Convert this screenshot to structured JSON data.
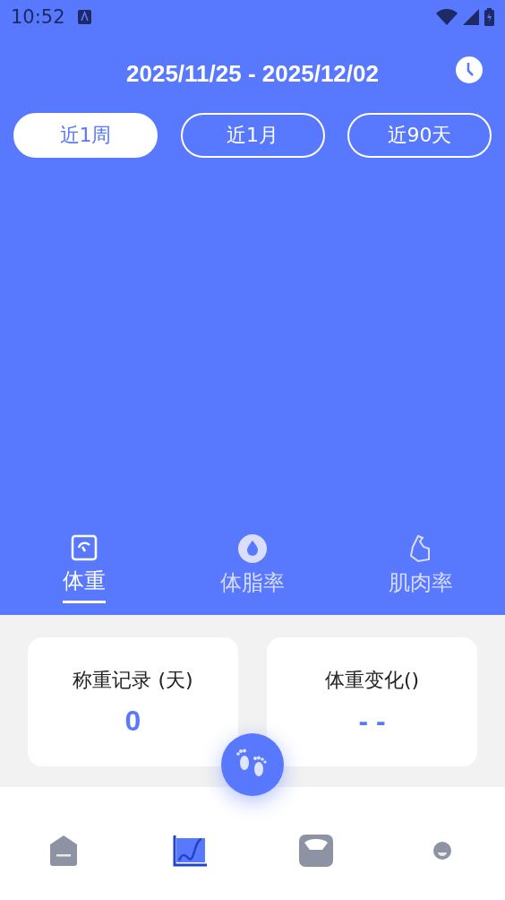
{
  "status_bar": {
    "time": "10:52"
  },
  "date_range": "2025/11/25 - 2025/12/02",
  "periods": [
    {
      "label": "近1周",
      "selected": true
    },
    {
      "label": "近1月",
      "selected": false
    },
    {
      "label": "近90天",
      "selected": false
    }
  ],
  "metrics": [
    {
      "kind": "scale",
      "label": "体重",
      "selected": true
    },
    {
      "kind": "drop",
      "label": "体脂率",
      "selected": false
    },
    {
      "kind": "muscle",
      "label": "肌肉率",
      "selected": false
    }
  ],
  "stats": [
    {
      "label": "称重记录 (天)",
      "value": "0"
    },
    {
      "label": "体重变化()",
      "value": "- -"
    }
  ],
  "nav": [
    {
      "kind": "home",
      "selected": false
    },
    {
      "kind": "chart",
      "selected": true
    },
    {
      "kind": "scale",
      "selected": false
    },
    {
      "kind": "profile",
      "selected": false
    }
  ]
}
